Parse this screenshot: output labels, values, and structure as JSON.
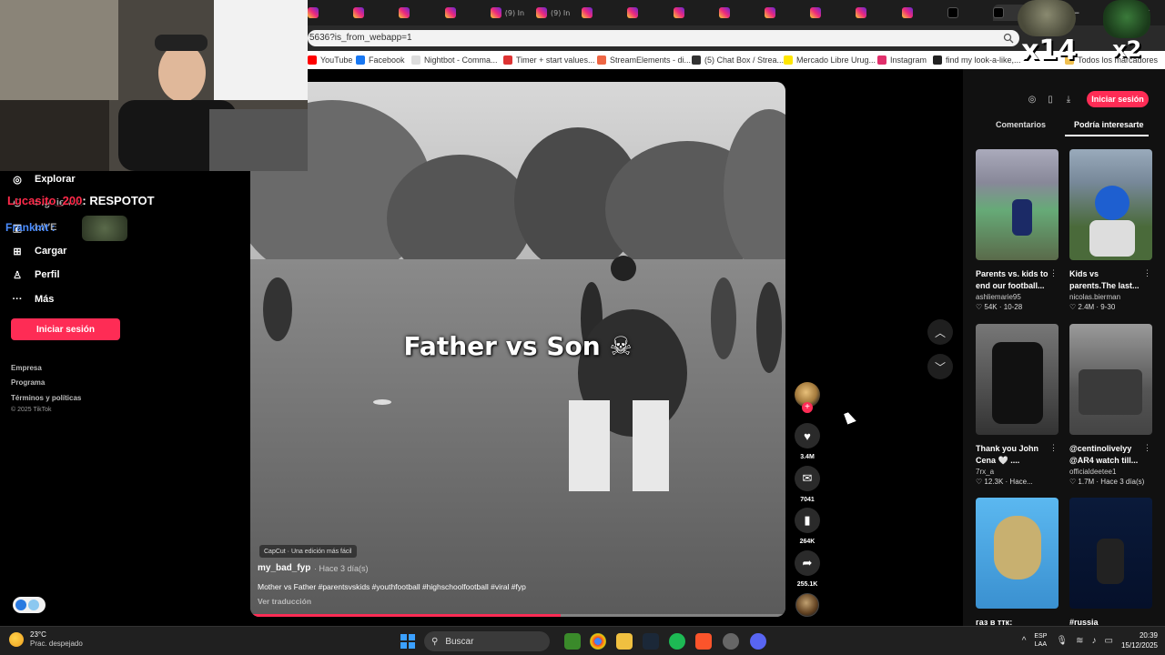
{
  "browser": {
    "tabs": [
      {
        "icon": "instagram-icon",
        "label": ""
      },
      {
        "icon": "instagram-icon",
        "label": ""
      },
      {
        "icon": "instagram-icon",
        "label": ""
      },
      {
        "icon": "instagram-icon",
        "label": ""
      },
      {
        "icon": "instagram-icon",
        "label": "(9) In"
      },
      {
        "icon": "instagram-icon",
        "label": "(9) In"
      },
      {
        "icon": "instagram-icon",
        "label": ""
      },
      {
        "icon": "instagram-icon",
        "label": ""
      },
      {
        "icon": "instagram-icon",
        "label": ""
      },
      {
        "icon": "instagram-icon",
        "label": ""
      },
      {
        "icon": "instagram-icon",
        "label": ""
      },
      {
        "icon": "instagram-icon",
        "label": ""
      },
      {
        "icon": "instagram-icon",
        "label": ""
      },
      {
        "icon": "instagram-icon",
        "label": ""
      },
      {
        "icon": "tiktok-icon",
        "label": ""
      },
      {
        "icon": "tiktok-icon",
        "label": ""
      }
    ],
    "url": "5636?is_from_webapp=1",
    "bookmarks": [
      {
        "label": "YouTube",
        "color": "#ff0000"
      },
      {
        "label": "Facebook",
        "color": "#1877f2"
      },
      {
        "label": "Nightbot - Comma...",
        "color": "#dddddd"
      },
      {
        "label": "Timer + start values...",
        "color": "#d33"
      },
      {
        "label": "StreamElements - di...",
        "color": "#e64"
      },
      {
        "label": "(5) Chat Box / Strea...",
        "color": "#333"
      },
      {
        "label": "Mercado Libre Urug...",
        "color": "#ffe600"
      },
      {
        "label": "Instagram",
        "color": "#e1306c"
      },
      {
        "label": "find my look-a-like,...",
        "color": "#222"
      }
    ],
    "bookmarks_all": "Todos los marcadores"
  },
  "sidebar": {
    "items": [
      {
        "icon": "compass-icon",
        "label": "Explorar"
      },
      {
        "icon": "following-icon",
        "label": "Siguiendo"
      },
      {
        "icon": "live-icon",
        "label": "LIVE"
      },
      {
        "icon": "upload-icon",
        "label": "Cargar"
      },
      {
        "icon": "profile-icon",
        "label": "Perfil"
      },
      {
        "icon": "more-icon",
        "label": "Más"
      }
    ],
    "login_button": "Iniciar sesión",
    "footer_links": [
      "Empresa",
      "Programa",
      "Términos y políticas"
    ],
    "copyright": "© 2025 TikTok"
  },
  "video": {
    "overlay_text": "Father vs Son",
    "capcut_badge": "CapCut · Una edición más fácil",
    "author": "my_bad_fyp",
    "posted": "· Hace 3 día(s)",
    "caption": "Mother vs Father #parentsvskids #youthfootball #highschoolfootball #viral #fyp",
    "translate_link": "Ver traducción",
    "progress": 0.58
  },
  "actions": {
    "likes": "3.4M",
    "comments": "7041",
    "saves": "264K",
    "shares": "255.1K"
  },
  "right_panel": {
    "login_button": "Iniciar sesión",
    "tabs": [
      "Comentarios",
      "Podría interesarte"
    ],
    "cards": [
      {
        "title": "Parents vs. kids to end our football...",
        "user": "ashliemarie95",
        "stats": "♡ 54K · 10-28"
      },
      {
        "title": "Kids vs parents.The last...",
        "user": "nicolas.bierman",
        "stats": "♡ 2.4M · 9-30"
      },
      {
        "title": "Thank you John Cena 🤍 ....",
        "user": "7rx_a",
        "stats": "♡ 12.3K · Hace..."
      },
      {
        "title": "@centinolivelyy @AR4 watch till...",
        "user": "officialdeetee1",
        "stats": "♡ 1.7M · Hace 3 día(s)"
      },
      {
        "title": "газ в ттк:",
        "user": "",
        "stats": ""
      },
      {
        "title": "#russia",
        "user": "",
        "stats": ""
      }
    ]
  },
  "stream_overlay": {
    "chat1_user": "Lucasito_200",
    "chat1_msg": ": RESPOTOT",
    "chat2_user": "Frankmt :",
    "multiplier1": "x14",
    "multiplier2": "x2"
  },
  "taskbar": {
    "temp": "23°C",
    "weather": "Prac. despejado",
    "search_placeholder": "Buscar",
    "lang_top": "ESP",
    "lang_bottom": "LAA",
    "time": "20:39",
    "date": "15/12/2025"
  },
  "colors": {
    "accent": "#fe2c55",
    "background": "#000000"
  }
}
